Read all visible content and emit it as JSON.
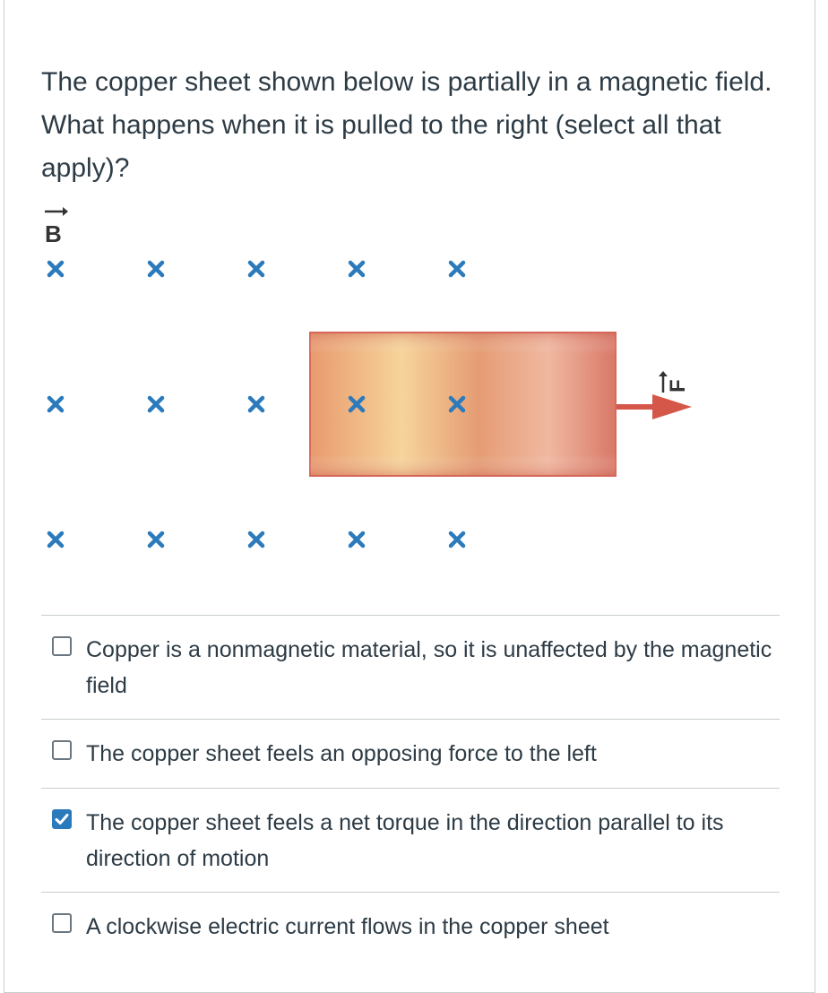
{
  "question": {
    "text": "The copper sheet shown below is partially in a magnetic field. What happens when it is pulled to the right (select all that apply)?"
  },
  "figure": {
    "field_label": "B",
    "force_label": "F",
    "field_symbol": "×",
    "colors": {
      "field_marker": "#2b7abc",
      "force_arrow": "#d5574a",
      "sheet_edge": "#d96a5e"
    }
  },
  "answers": [
    {
      "text": "Copper is a nonmagnetic material, so it is unaffected by the magnetic field",
      "checked": false
    },
    {
      "text": "The copper sheet feels an opposing force to the left",
      "checked": false
    },
    {
      "text": "The copper sheet feels a net torque in the direction parallel to its direction of motion",
      "checked": true
    },
    {
      "text": "A clockwise electric current flows in the copper sheet",
      "checked": false
    }
  ]
}
